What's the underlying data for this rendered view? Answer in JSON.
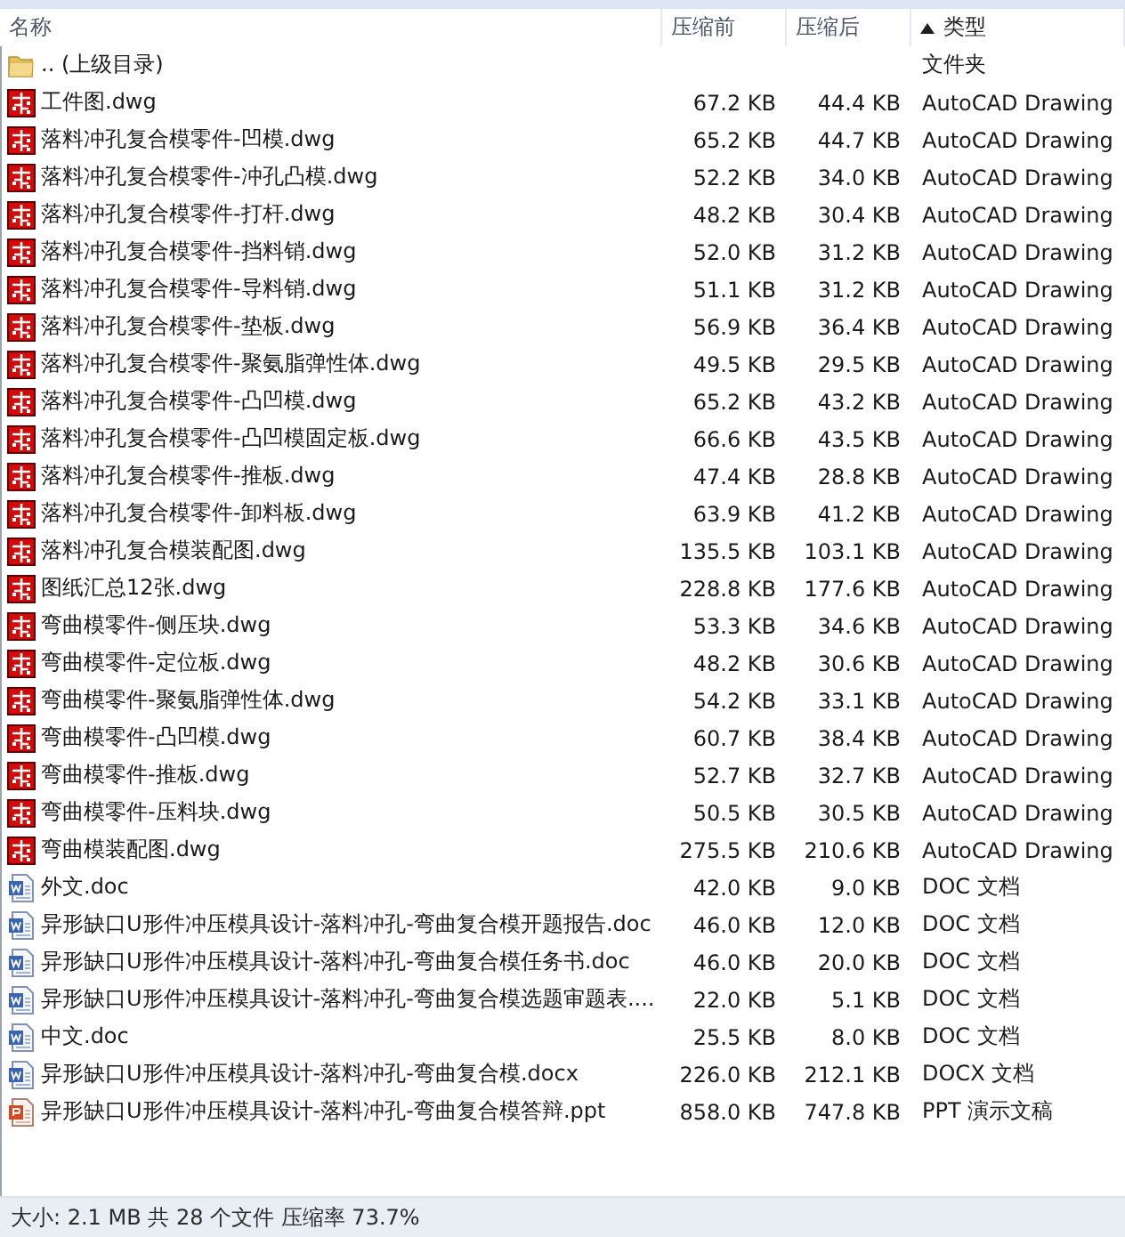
{
  "columns": [
    {
      "label": "名称",
      "sorted": false
    },
    {
      "label": "压缩前",
      "sorted": false
    },
    {
      "label": "压缩后",
      "sorted": false
    },
    {
      "label": "类型",
      "sorted": true
    }
  ],
  "rows": [
    {
      "kind": "folder",
      "name": ".. (上级目录)",
      "type": "文件夹"
    },
    {
      "kind": "dwg",
      "name": "工件图.dwg",
      "size_before": "67.2 KB",
      "size_after": "44.4 KB",
      "type": "AutoCAD Drawing"
    },
    {
      "kind": "dwg",
      "name": "落料冲孔复合模零件-凹模.dwg",
      "size_before": "65.2 KB",
      "size_after": "44.7 KB",
      "type": "AutoCAD Drawing"
    },
    {
      "kind": "dwg",
      "name": "落料冲孔复合模零件-冲孔凸模.dwg",
      "size_before": "52.2 KB",
      "size_after": "34.0 KB",
      "type": "AutoCAD Drawing"
    },
    {
      "kind": "dwg",
      "name": "落料冲孔复合模零件-打杆.dwg",
      "size_before": "48.2 KB",
      "size_after": "30.4 KB",
      "type": "AutoCAD Drawing"
    },
    {
      "kind": "dwg",
      "name": "落料冲孔复合模零件-挡料销.dwg",
      "size_before": "52.0 KB",
      "size_after": "31.2 KB",
      "type": "AutoCAD Drawing"
    },
    {
      "kind": "dwg",
      "name": "落料冲孔复合模零件-导料销.dwg",
      "size_before": "51.1 KB",
      "size_after": "31.2 KB",
      "type": "AutoCAD Drawing"
    },
    {
      "kind": "dwg",
      "name": "落料冲孔复合模零件-垫板.dwg",
      "size_before": "56.9 KB",
      "size_after": "36.4 KB",
      "type": "AutoCAD Drawing"
    },
    {
      "kind": "dwg",
      "name": "落料冲孔复合模零件-聚氨脂弹性体.dwg",
      "size_before": "49.5 KB",
      "size_after": "29.5 KB",
      "type": "AutoCAD Drawing"
    },
    {
      "kind": "dwg",
      "name": "落料冲孔复合模零件-凸凹模.dwg",
      "size_before": "65.2 KB",
      "size_after": "43.2 KB",
      "type": "AutoCAD Drawing"
    },
    {
      "kind": "dwg",
      "name": "落料冲孔复合模零件-凸凹模固定板.dwg",
      "size_before": "66.6 KB",
      "size_after": "43.5 KB",
      "type": "AutoCAD Drawing"
    },
    {
      "kind": "dwg",
      "name": "落料冲孔复合模零件-推板.dwg",
      "size_before": "47.4 KB",
      "size_after": "28.8 KB",
      "type": "AutoCAD Drawing"
    },
    {
      "kind": "dwg",
      "name": "落料冲孔复合模零件-卸料板.dwg",
      "size_before": "63.9 KB",
      "size_after": "41.2 KB",
      "type": "AutoCAD Drawing"
    },
    {
      "kind": "dwg",
      "name": "落料冲孔复合模装配图.dwg",
      "size_before": "135.5 KB",
      "size_after": "103.1 KB",
      "type": "AutoCAD Drawing"
    },
    {
      "kind": "dwg",
      "name": "图纸汇总12张.dwg",
      "size_before": "228.8 KB",
      "size_after": "177.6 KB",
      "type": "AutoCAD Drawing"
    },
    {
      "kind": "dwg",
      "name": "弯曲模零件-侧压块.dwg",
      "size_before": "53.3 KB",
      "size_after": "34.6 KB",
      "type": "AutoCAD Drawing"
    },
    {
      "kind": "dwg",
      "name": "弯曲模零件-定位板.dwg",
      "size_before": "48.2 KB",
      "size_after": "30.6 KB",
      "type": "AutoCAD Drawing"
    },
    {
      "kind": "dwg",
      "name": "弯曲模零件-聚氨脂弹性体.dwg",
      "size_before": "54.2 KB",
      "size_after": "33.1 KB",
      "type": "AutoCAD Drawing"
    },
    {
      "kind": "dwg",
      "name": "弯曲模零件-凸凹模.dwg",
      "size_before": "60.7 KB",
      "size_after": "38.4 KB",
      "type": "AutoCAD Drawing"
    },
    {
      "kind": "dwg",
      "name": "弯曲模零件-推板.dwg",
      "size_before": "52.7 KB",
      "size_after": "32.7 KB",
      "type": "AutoCAD Drawing"
    },
    {
      "kind": "dwg",
      "name": "弯曲模零件-压料块.dwg",
      "size_before": "50.5 KB",
      "size_after": "30.5 KB",
      "type": "AutoCAD Drawing"
    },
    {
      "kind": "dwg",
      "name": "弯曲模装配图.dwg",
      "size_before": "275.5 KB",
      "size_after": "210.6 KB",
      "type": "AutoCAD Drawing"
    },
    {
      "kind": "doc",
      "name": "外文.doc",
      "size_before": "42.0 KB",
      "size_after": "9.0 KB",
      "type": "DOC 文档"
    },
    {
      "kind": "doc",
      "name": "异形缺口U形件冲压模具设计-落料冲孔-弯曲复合模开题报告.doc",
      "size_before": "46.0 KB",
      "size_after": "12.0 KB",
      "type": "DOC 文档"
    },
    {
      "kind": "doc",
      "name": "异形缺口U形件冲压模具设计-落料冲孔-弯曲复合模任务书.doc",
      "size_before": "46.0 KB",
      "size_after": "20.0 KB",
      "type": "DOC 文档"
    },
    {
      "kind": "doc",
      "name": "异形缺口U形件冲压模具设计-落料冲孔-弯曲复合模选题审题表....",
      "size_before": "22.0 KB",
      "size_after": "5.1 KB",
      "type": "DOC 文档"
    },
    {
      "kind": "doc",
      "name": "中文.doc",
      "size_before": "25.5 KB",
      "size_after": "8.0 KB",
      "type": "DOC 文档"
    },
    {
      "kind": "doc",
      "name": "异形缺口U形件冲压模具设计-落料冲孔-弯曲复合模.docx",
      "size_before": "226.0 KB",
      "size_after": "212.1 KB",
      "type": "DOCX 文档"
    },
    {
      "kind": "ppt",
      "name": "异形缺口U形件冲压模具设计-落料冲孔-弯曲复合模答辩.ppt",
      "size_before": "858.0 KB",
      "size_after": "747.8 KB",
      "type": "PPT 演示文稿"
    }
  ],
  "status_bar": {
    "text": "大小: 2.1 MB 共 28 个文件 压缩率 73.7%"
  }
}
